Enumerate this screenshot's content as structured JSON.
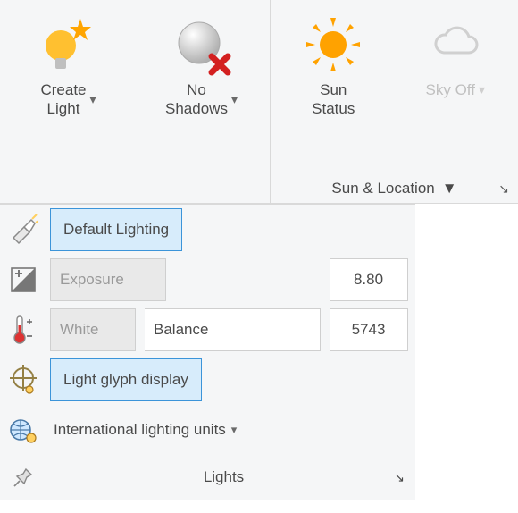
{
  "ribbon": {
    "create_light": "Create\nLight",
    "no_shadows": "No\nShadows",
    "sun_status": "Sun\nStatus",
    "sky_off": "Sky Off",
    "group2_caption": "Sun & Location"
  },
  "panel": {
    "default_lighting": "Default Lighting",
    "exposure_label": "Exposure",
    "exposure_value": "8.80",
    "white_label": "White",
    "balance_label": "Balance",
    "white_balance_value": "5743",
    "light_glyph": "Light glyph display",
    "intl_units": "International lighting units",
    "footer_caption": "Lights"
  }
}
